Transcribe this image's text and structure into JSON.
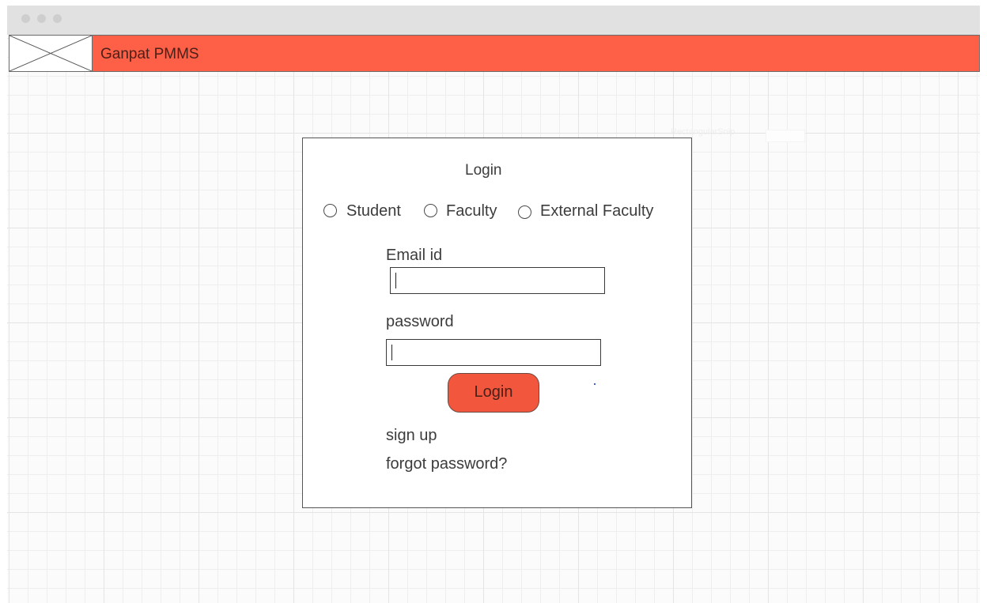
{
  "app": {
    "title": "Ganpat PMMS",
    "brand_color": "#fe6047"
  },
  "canvas_hint": {
    "ghost_text": "RectangularSnip"
  },
  "login": {
    "title": "Login",
    "roles": [
      {
        "label": "Student",
        "selected": false
      },
      {
        "label": "Faculty",
        "selected": false
      },
      {
        "label": "External Faculty",
        "selected": false
      }
    ],
    "email": {
      "label": "Email id",
      "value": "",
      "placeholder": ""
    },
    "password": {
      "label": "password",
      "value": "",
      "placeholder": ""
    },
    "submit_label": "Login",
    "signup_label": "sign up",
    "forgot_label": "forgot password?"
  },
  "icons": {
    "logo": "image-placeholder-icon",
    "radio": "radio-unchecked-icon"
  }
}
